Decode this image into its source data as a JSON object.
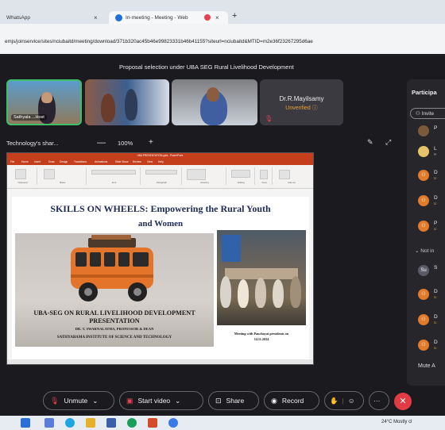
{
  "browser": {
    "tabs": [
      {
        "label": "WhatsApp",
        "close": "×"
      },
      {
        "label": "In-meeting - Meeting - Web",
        "close": "×"
      }
    ],
    "new_tab": "+",
    "url": "emjs/joinservice/sites/nciubaitd/meeting/download/371b320ac45b46e99823331b46b41155?siteurl=nciubaitd&MTID=m2e36f23267295d6ae"
  },
  "meeting": {
    "title": "Proposal selection under UBA SEG Rural Livelihood Development",
    "tiles": [
      {
        "name": "Sathyala ...Host"
      },
      {
        "name": ""
      },
      {
        "name": ""
      },
      {
        "name": "Dr.R.Mayilsamy",
        "status": "Unverified ⓘ"
      }
    ],
    "share_label": "Technology's shar...",
    "zoom": "100%",
    "zoom_minus": "—",
    "zoom_plus": "+"
  },
  "powerpoint": {
    "window_title": "UBA PRESENTATION.pptx - PowerPoint",
    "menus": [
      "File",
      "Home",
      "Insert",
      "Draw",
      "Design",
      "Transitions",
      "Animations",
      "Slide Show",
      "Review",
      "View",
      "Help"
    ],
    "ribbon_groups": [
      "Clipboard",
      "Slides",
      "Font",
      "Paragraph",
      "Drawing",
      "Editing",
      "Voice",
      "Add-ins"
    ]
  },
  "slide": {
    "title_line1": "SKILLS ON WHEELS: Empowering the Rural Youth",
    "title_line2": "and Women",
    "heading_line1": "UBA-SEG ON RURAL LIVELIHOOD DEVELOPMENT",
    "heading_line2": "PRESENTATION",
    "presenter": "DR. T. SWARNALATHA, PROFESSOR & DEAN",
    "institute": "SATHYABAMA INSTITUTE OF SCIENCE AND TECHNOLOGY",
    "photo_caption_line1": "Meeting with Panchayat presidents on",
    "photo_caption_line2": "14.11.2024"
  },
  "participants": {
    "title": "Participa",
    "invite_label": "Invite",
    "rows": [
      {
        "initial": "P",
        "sub": ""
      },
      {
        "initial": "L",
        "sub": "H"
      },
      {
        "initial": "D",
        "sub": "U"
      },
      {
        "initial": "D",
        "sub": "U"
      },
      {
        "initial": "P",
        "sub": "U"
      }
    ],
    "not_in_label": "Not in",
    "rows2": [
      {
        "avatar": "Su",
        "initial": "S",
        "sub": ""
      },
      {
        "initial": "D",
        "sub": "U"
      },
      {
        "initial": "D",
        "sub": "U"
      },
      {
        "initial": "D",
        "sub": "U"
      }
    ],
    "mute_all": "Mute A"
  },
  "controls": {
    "unmute": "Unmute",
    "start_video": "Start video",
    "share": "Share",
    "record": "Record",
    "more": "···"
  },
  "taskbar": {
    "weather": "24°C  Mostly cl"
  },
  "colors": {
    "accent_orange": "#e07b2b",
    "leave_red": "#e23b44",
    "ppt_red": "#c43e1c",
    "active_speaker_green": "#3fbf6b"
  }
}
